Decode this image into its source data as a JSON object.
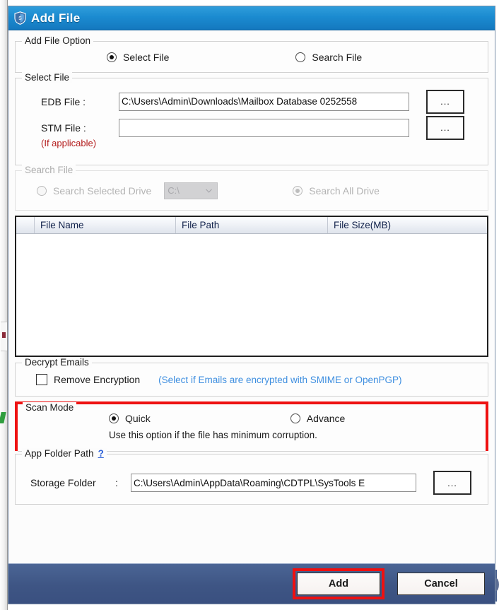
{
  "window": {
    "title": "Add File",
    "title_icon": "shield-icon"
  },
  "add_file_option": {
    "legend": "Add File Option",
    "options": [
      {
        "label": "Select File",
        "selected": true
      },
      {
        "label": "Search File",
        "selected": false
      }
    ]
  },
  "select_file": {
    "legend": "Select File",
    "edb_label": "EDB File :",
    "edb_value": "C:\\Users\\Admin\\Downloads\\Mailbox Database 0252558",
    "stm_label": "STM File :",
    "stm_value": "",
    "stm_note": "(If applicable)",
    "browse_label": "...",
    "browse_label_2": "..."
  },
  "search_file": {
    "legend": "Search File",
    "selected_drive_label": "Search Selected Drive",
    "drive_value": "C:\\",
    "all_drive_label": "Search All Drive",
    "enabled": false
  },
  "file_list": {
    "columns": [
      "",
      "File Name",
      "File Path",
      "File Size(MB)"
    ],
    "rows": []
  },
  "decrypt": {
    "legend": "Decrypt Emails",
    "checkbox_label": "Remove Encryption",
    "hint": "(Select if Emails are encrypted with SMIME or OpenPGP)",
    "checked": false
  },
  "scan_mode": {
    "legend": "Scan Mode",
    "options": [
      {
        "label": "Quick",
        "selected": true
      },
      {
        "label": "Advance",
        "selected": false
      }
    ],
    "note": "Use this option if the file has minimum corruption.",
    "highlight_color": "#ee1111"
  },
  "app_folder": {
    "legend": "App Folder Path",
    "help_link": "?",
    "storage_label": "Storage Folder",
    "colon": ":",
    "storage_value": "C:\\Users\\Admin\\AppData\\Roaming\\CDTPL\\SysTools E",
    "browse_label": "..."
  },
  "footer": {
    "add_label": "Add",
    "cancel_label": "Cancel",
    "highlight_color": "#ee1111"
  },
  "colors": {
    "titlebar_blue": "#1b8bd0",
    "footer_blue": "#3e5584",
    "hint_blue": "#3f8fe0",
    "note_red": "#b31b1b",
    "highlight_red": "#ee1111"
  }
}
